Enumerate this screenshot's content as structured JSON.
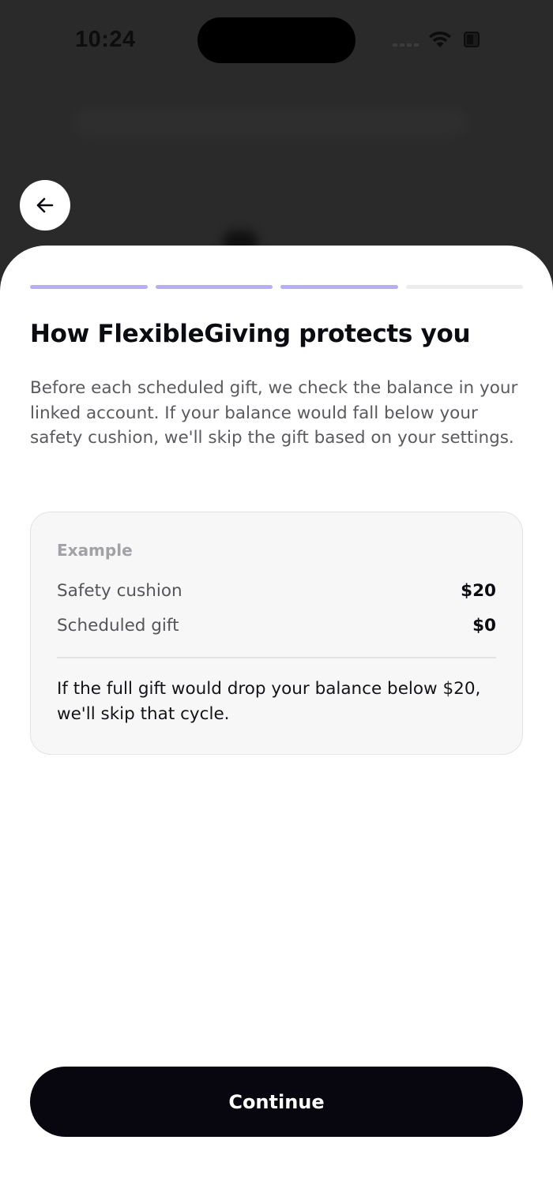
{
  "status_bar": {
    "time": "10:24"
  },
  "header": {
    "back_icon": "arrow-left-icon"
  },
  "progress": {
    "total_steps": 4,
    "current_step": 3
  },
  "content": {
    "title": "How FlexibleGiving protects you",
    "description": "Before each scheduled gift, we check the balance in your linked account. If your balance would fall below your safety cushion, we'll skip the gift based on your settings."
  },
  "example": {
    "label": "Example",
    "rows": [
      {
        "label": "Safety cushion",
        "value": "$20"
      },
      {
        "label": "Scheduled gift",
        "value": "$0"
      }
    ],
    "note": "If the full gift would drop your balance below $20, we'll skip that cycle."
  },
  "footer": {
    "continue_label": "Continue"
  },
  "colors": {
    "progress_active": "#b8aef7",
    "progress_inactive": "#ececec",
    "primary_button": "#08070f",
    "backdrop": "#2a2a2a"
  }
}
